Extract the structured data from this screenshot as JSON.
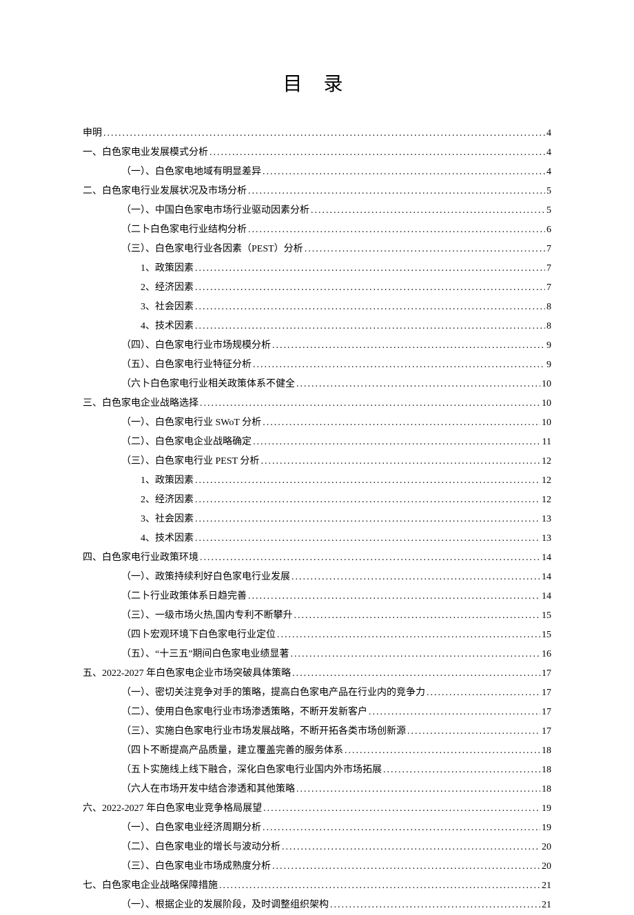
{
  "title": "目 录",
  "toc": [
    {
      "level": 0,
      "label": "申明",
      "page": "4"
    },
    {
      "level": 0,
      "label": "一、白色家电业发展模式分析",
      "page": "4"
    },
    {
      "level": 1,
      "label": "（一）、白色家电地域有明显差异",
      "page": "4"
    },
    {
      "level": 0,
      "label": "二、白色家电行业发展状况及市场分析",
      "page": "5"
    },
    {
      "level": 1,
      "label": "（一）、中国白色家电市场行业驱动因素分析",
      "page": "5"
    },
    {
      "level": 1,
      "label": "（二卜白色家电行业结构分析",
      "page": "6"
    },
    {
      "level": 1,
      "label": "（三）、白色家电行业各因素（PEST）分析",
      "page": "7"
    },
    {
      "level": 2,
      "label": "1、政策因素",
      "page": "7"
    },
    {
      "level": 2,
      "label": "2、经济因素",
      "page": "7"
    },
    {
      "level": 2,
      "label": "3、社会因素",
      "page": "8"
    },
    {
      "level": 2,
      "label": "4、技术因素",
      "page": "8"
    },
    {
      "level": 1,
      "label": "（四）、白色家电行业市场规模分析",
      "page": "9"
    },
    {
      "level": 1,
      "label": "（五）、白色家电行业特征分析",
      "page": "9"
    },
    {
      "level": 1,
      "label": "（六卜白色家电行业相关政策体系不健全",
      "page": "10"
    },
    {
      "level": 0,
      "label": "三、白色家电企业战略选择",
      "page": "10"
    },
    {
      "level": 1,
      "label": "（一）、白色家电行业 SWoT 分析",
      "page": "10"
    },
    {
      "level": 1,
      "label": "（二）、白色家电企业战略确定",
      "page": "11"
    },
    {
      "level": 1,
      "label": "（三）、白色家电行业 PEST 分析",
      "page": "12"
    },
    {
      "level": 2,
      "label": "1、政策因素",
      "page": "12"
    },
    {
      "level": 2,
      "label": "2、经济因素",
      "page": "12"
    },
    {
      "level": 2,
      "label": "3、社会因素",
      "page": "13"
    },
    {
      "level": 2,
      "label": "4、技术因素",
      "page": "13"
    },
    {
      "level": 0,
      "label": "四、白色家电行业政策环境",
      "page": "14"
    },
    {
      "level": 1,
      "label": "（一）、政策持续利好白色家电行业发展",
      "page": "14"
    },
    {
      "level": 1,
      "label": "（二卜行业政策体系日趋完善",
      "page": "14"
    },
    {
      "level": 1,
      "label": "（三）、一级市场火热,国内专利不断攀升",
      "page": "15"
    },
    {
      "level": 1,
      "label": "（四卜宏观环境下白色家电行业定位",
      "page": "15"
    },
    {
      "level": 1,
      "label": "（五）、“十三五”期间白色家电业绩显著",
      "page": "16"
    },
    {
      "level": 0,
      "label": "五、2022-2027 年白色家电企业市场突破具体策略",
      "page": "17"
    },
    {
      "level": 1,
      "label": "（一）、密切关注竞争对手的策略，提高白色家电产品在行业内的竞争力",
      "page": "17"
    },
    {
      "level": 1,
      "label": "（二）、使用白色家电行业市场渗透策略，不断开发新客户",
      "page": "17"
    },
    {
      "level": 1,
      "label": "（三）、实施白色家电行业市场发展战略，不断开拓各类市场创新源",
      "page": "17"
    },
    {
      "level": 1,
      "label": "（四卜不断提高产品质量，建立覆盖完善的服务体系",
      "page": "18"
    },
    {
      "level": 1,
      "label": "（五卜实施线上线下融合，深化白色家电行业国内外市场拓展",
      "page": "18"
    },
    {
      "level": 1,
      "label": "（六人在市场开发中结合渗透和其他策略",
      "page": "18"
    },
    {
      "level": 0,
      "label": "六、2022-2027 年白色家电业竞争格局展望",
      "page": "19"
    },
    {
      "level": 1,
      "label": "（一）、白色家电业经济周期分析",
      "page": "19"
    },
    {
      "level": 1,
      "label": "（二）、白色家电业的增长与波动分析",
      "page": "20"
    },
    {
      "level": 1,
      "label": "（三）、白色家电业市场成熟度分析",
      "page": "20"
    },
    {
      "level": 0,
      "label": "七、白色家电企业战略保障措施",
      "page": "21"
    },
    {
      "level": 1,
      "label": "（一）、根据企业的发展阶段，及时调整组织架构",
      "page": "21"
    }
  ]
}
